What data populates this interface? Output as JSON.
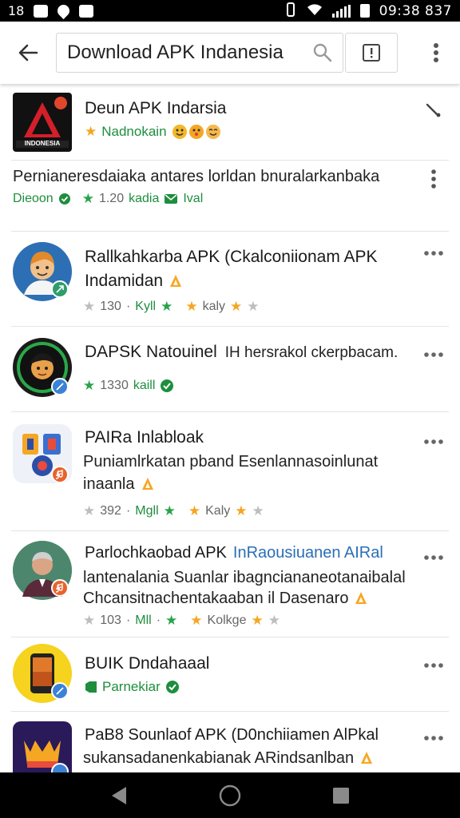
{
  "status_bar": {
    "left_text": "18",
    "time": "09:38 837"
  },
  "search": {
    "query": "Download APK Indanesia"
  },
  "results": [
    {
      "title": "Deun APK Indarsia",
      "subtitle": "Nadnokain",
      "icon_text": "INDONESIA",
      "promo_text": "Pernianeresdaiaka antares lorldan bnuralarkanbaka",
      "promo_meta": {
        "brand": "Dieoon",
        "rating": "1.20",
        "label": "kadia",
        "tag": "Ival"
      }
    },
    {
      "title_line1": "Rallkahkarba APK (Ckalconiionam APK",
      "title_line2": "Indamidan",
      "rating": "130",
      "label1": "Kyll",
      "label2": "kaly"
    },
    {
      "title": "DAPSK Natouinel",
      "title_suffix": "IH hersrakol ckerpbacam.",
      "rating": "1330",
      "label": "kaill"
    },
    {
      "title": "PAIRa Inlabloak",
      "desc_line1": "Puniamlrkatan pband Esenlannasoinlunat",
      "desc_line2": "inaanla",
      "rating": "392",
      "label1": "Mgll",
      "label2": "Kaly"
    },
    {
      "title": "Parlochkaobad APK",
      "title_link": "InRaousiuanen AIRal",
      "desc_line1": "lantenalania Suanlar ibagnciananeotanaibalal",
      "desc_line2": "Chcansitnachentakaaban il Dasenaro",
      "rating": "103",
      "label1": "Mll",
      "label2": "Kolkge"
    },
    {
      "title": "BUIK Dndahaaal",
      "subtitle": "Parnekiar"
    },
    {
      "title": "PaB8 Sounlaof APK (D0nchiiamen AlPkal",
      "desc_line1": "sukansadanenkabianak ARindsanlban"
    }
  ],
  "colors": {
    "accent_green": "#1e8e3e",
    "star_orange": "#f5a623",
    "badge_blue": "#3b82d6",
    "badge_orange": "#e8622d"
  }
}
